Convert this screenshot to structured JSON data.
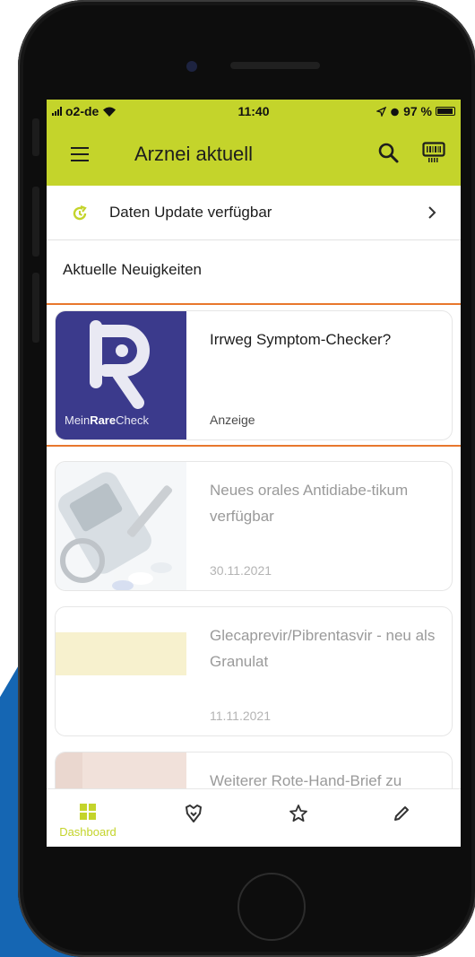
{
  "status_bar": {
    "carrier": "o2-de",
    "time": "11:40",
    "battery": "97 %",
    "battery_level": 0.97
  },
  "app_bar": {
    "title": "Arznei aktuell",
    "icons": [
      "menu-icon",
      "search-icon",
      "barcode-icon"
    ]
  },
  "update_banner": {
    "label": "Daten Update verfügbar",
    "icon": "refresh-icon"
  },
  "news": {
    "heading": "Aktuelle Neuigkeiten",
    "items": [
      {
        "title": "Irrweg Symptom-Checker?",
        "meta": "Anzeige",
        "logo_text_plain_1": "Mein",
        "logo_text_bold": "Rare",
        "logo_text_plain_2": "Check"
      },
      {
        "title": "Neues orales Antidiabe-tikum verfügbar",
        "meta": "30.11.2021"
      },
      {
        "title": "Glecaprevir/Pibrentasvir - neu als Granulat",
        "meta": "11.11.2021"
      },
      {
        "title": "Weiterer Rote-Hand-Brief zu",
        "meta": ""
      }
    ]
  },
  "bottom_nav": {
    "items": [
      {
        "label": "Dashboard",
        "icon": "dashboard-icon",
        "active": true
      },
      {
        "label": "",
        "icon": "interactions-icon"
      },
      {
        "label": "",
        "icon": "star-icon"
      },
      {
        "label": "",
        "icon": "pencil-icon"
      }
    ]
  },
  "colors": {
    "accent": "#c4d42b",
    "highlight": "#e8772d",
    "logo_bg": "#3b3a8c",
    "background_blue": "#1566b3"
  }
}
